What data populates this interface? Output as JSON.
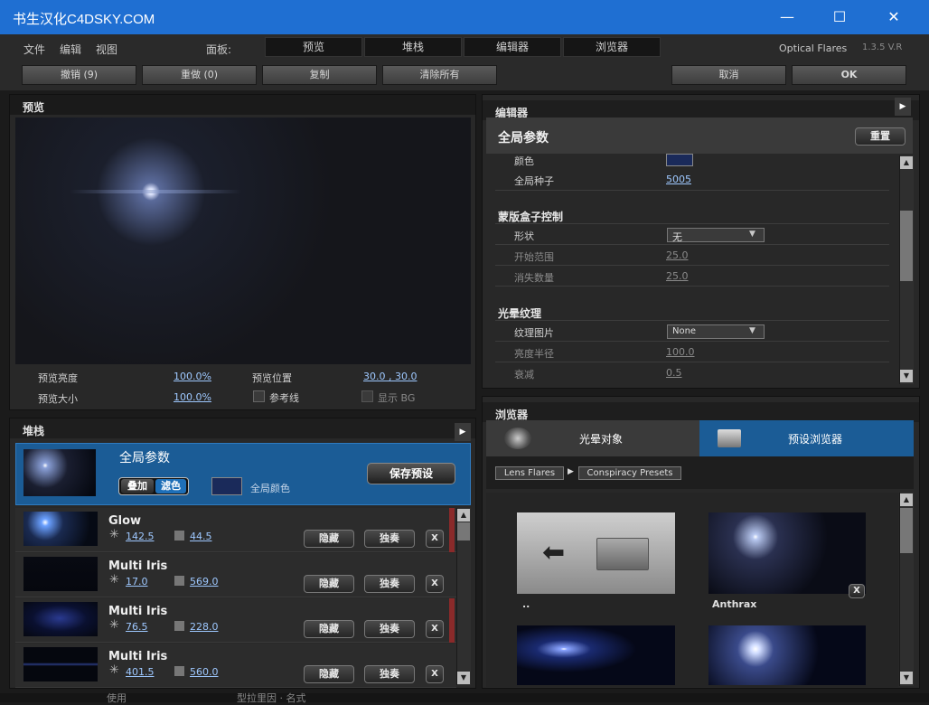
{
  "window": {
    "title": "书生汉化C4DSKY.COM",
    "minimize": "—",
    "maximize": "☐",
    "close": "✕"
  },
  "menu": {
    "items": [
      "文件",
      "编辑",
      "视图"
    ],
    "panels_label": "面板:",
    "panels": [
      "预览",
      "堆栈",
      "编辑器",
      "浏览器"
    ],
    "brand": "Optical Flares",
    "version": "1.3.5 V.R"
  },
  "toolbar": {
    "undo": "撤销 (9)",
    "redo": "重做 (0)",
    "copy": "复制",
    "clear_all": "清除所有",
    "cancel": "取消",
    "ok": "OK"
  },
  "preview": {
    "title": "预览",
    "brightness_label": "预览亮度",
    "brightness_value": "100.0%",
    "size_label": "预览大小",
    "size_value": "100.0%",
    "position_label": "预览位置",
    "position_value": "30.0 , 30.0",
    "guides_label": "参考线",
    "show_bg_label": "显示 BG"
  },
  "stack": {
    "title": "堆栈",
    "global": {
      "label": "全局参数",
      "add": "叠加",
      "filter": "滤色",
      "color_label": "全局颜色",
      "save_preset": "保存预设",
      "color": "#1a2a5a"
    },
    "items": [
      {
        "name": "Glow",
        "brightness": "142.5",
        "scale": "44.5",
        "hide": "隐藏",
        "solo": "独奏",
        "del": "X"
      },
      {
        "name": "Multi Iris",
        "brightness": "17.0",
        "scale": "569.0",
        "hide": "隐藏",
        "solo": "独奏",
        "del": "X"
      },
      {
        "name": "Multi Iris",
        "brightness": "76.5",
        "scale": "228.0",
        "hide": "隐藏",
        "solo": "独奏",
        "del": "X"
      },
      {
        "name": "Multi Iris",
        "brightness": "401.5",
        "scale": "560.0",
        "hide": "隐藏",
        "solo": "独奏",
        "del": "X"
      }
    ]
  },
  "editor": {
    "title": "编辑器",
    "section": "全局参数",
    "reset": "重置",
    "color_label": "颜色",
    "seed_label": "全局种子",
    "seed_value": "5005",
    "mask_section": "蒙版盒子控制",
    "shape_label": "形状",
    "shape_value": "无",
    "start_label": "开始范围",
    "start_value": "25.0",
    "fade_label": "消失数量",
    "fade_value": "25.0",
    "texture_section": "光晕纹理",
    "texture_label": "纹理图片",
    "texture_value": "None",
    "bright_radius_label": "亮度半径",
    "bright_radius_value": "100.0",
    "decay_label": "衰减",
    "decay_value": "0.5"
  },
  "browser": {
    "title": "浏览器",
    "tab_objects": "光晕对象",
    "tab_presets": "预设浏览器",
    "crumbs": [
      "Lens Flares",
      "Conspiracy Presets"
    ],
    "items": [
      {
        "label": ".."
      },
      {
        "label": "Anthrax",
        "del": "X"
      },
      {
        "label": ""
      },
      {
        "label": ""
      }
    ]
  },
  "taskbar": {
    "items": [
      "使用",
      "型拉里因 · 名式"
    ]
  }
}
